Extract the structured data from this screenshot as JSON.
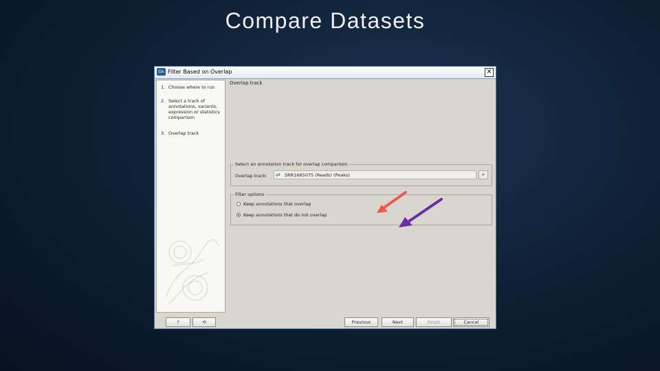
{
  "slide": {
    "title": "Compare Datasets"
  },
  "dialog": {
    "title": "Filter Based on Overlap",
    "app_icon": "Gx",
    "close_icon": "close-icon"
  },
  "steps": [
    {
      "num": "1.",
      "label": "Choose where to run"
    },
    {
      "num": "2.",
      "label": "Select a track of annotations, variants, expression or statistics comparison"
    },
    {
      "num": "3.",
      "label": "Overlap track"
    }
  ],
  "panel": {
    "title": "Overlap track",
    "track_group": {
      "legend": "Select an annotation track for overlap comparison",
      "label": "Overlap track:",
      "value": "SRR1665075 (Reads) (Peaks)"
    },
    "filter_group": {
      "legend": "Filter options",
      "options": [
        {
          "label": "Keep annotations that overlap",
          "selected": false
        },
        {
          "label": "Keep annotations that do not overlap",
          "selected": true
        }
      ]
    }
  },
  "annotations": {
    "arrow_red_color": "#ef5a4a",
    "arrow_purple_color": "#6a2fa3"
  },
  "footer": {
    "help_label": "?",
    "restore_icon": "restore-icon",
    "previous_label": "Previous",
    "next_label": "Next",
    "finish_label": "Finish",
    "cancel_label": "Cancel"
  }
}
